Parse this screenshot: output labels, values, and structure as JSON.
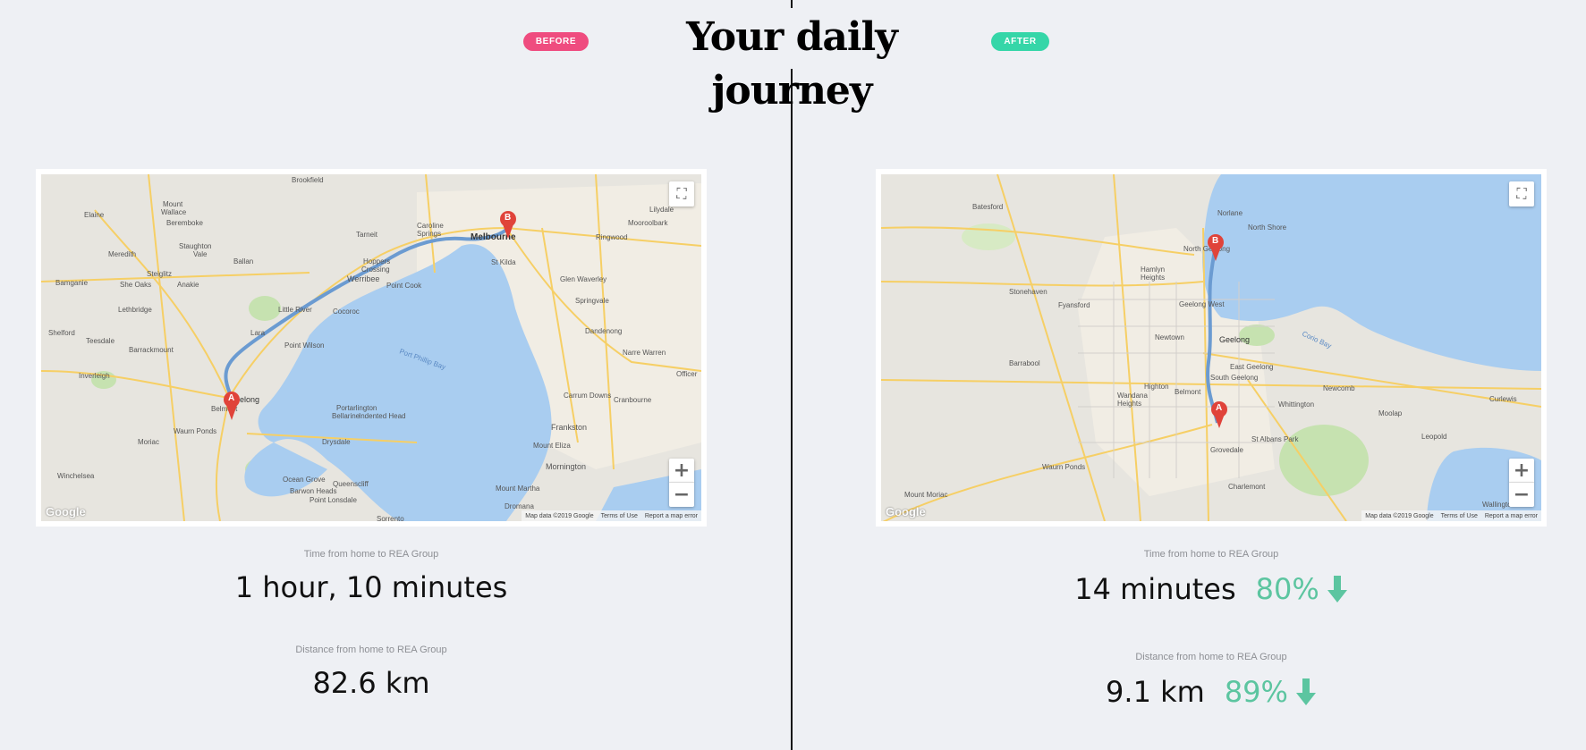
{
  "header": {
    "title": "Your daily journey",
    "before_label": "BEFORE",
    "after_label": "AFTER"
  },
  "before": {
    "map": {
      "place_labels": [
        "Brookfield",
        "Mount Wallace",
        "Elaine",
        "Beremboke",
        "Staughton Vale",
        "Meredith",
        "Ballan",
        "Tarneit",
        "Caroline Springs",
        "Melbourne",
        "St Kilda",
        "Ringwood",
        "Mooroolbark",
        "Lilydale",
        "Werribee",
        "Hoppers Crossing",
        "Point Cook",
        "Little River",
        "Cocoroc",
        "Anakie",
        "She Oaks",
        "Steiglitz",
        "Bamganie",
        "Lethbridge",
        "Shelford",
        "Teesdale",
        "Lara",
        "Point Wilson",
        "Barrackmount",
        "Inverleigh",
        "Geelong",
        "Belmont",
        "Waurn Ponds",
        "Moriac",
        "Winchelsea",
        "Portarlington",
        "Bellarine",
        "Indented Head",
        "Drysdale",
        "Ocean Grove",
        "Barwon Heads",
        "Queenscliff",
        "Point Lonsdale",
        "Port Phillip Bay",
        "Glen Waverley",
        "Springvale",
        "Dandenong",
        "Narre Warren",
        "Officer",
        "Carrum Downs",
        "Cranbourne",
        "Frankston",
        "Mount Eliza",
        "Mornington",
        "Mount Martha",
        "Dromana",
        "Sorrento"
      ],
      "route_color": "#6b9bd1",
      "marker_a": "A",
      "marker_b": "B",
      "google": "Google",
      "map_data": "Map data ©2019 Google",
      "terms": "Terms of Use",
      "report": "Report a map error"
    },
    "time_label": "Time from home to REA Group",
    "time_value": "1 hour, 10 minutes",
    "distance_label": "Distance from home to REA Group",
    "distance_value": "82.6 km"
  },
  "after": {
    "map": {
      "place_labels": [
        "Batesford",
        "Norlane",
        "North Shore",
        "North Geelong",
        "Hamlyn Heights",
        "Stonehaven",
        "Fyansford",
        "Geelong West",
        "Geelong",
        "Newtown",
        "Barrabool",
        "East Geelong",
        "South Geelong",
        "Newcomb",
        "Whittington",
        "Moolap",
        "Curlewis",
        "Highton",
        "Wandana Heights",
        "Belmont",
        "Leopold",
        "St Albans Park",
        "Grovedale",
        "Waurn Ponds",
        "Charlemont",
        "Mount Moriac",
        "Wallington",
        "Corio Bay"
      ],
      "route_color": "#6b9bd1",
      "marker_a": "A",
      "marker_b": "B",
      "google": "Google",
      "map_data": "Map data ©2019 Google",
      "terms": "Terms of Use",
      "report": "Report a map error"
    },
    "time_label": "Time from home to REA Group",
    "time_value": "14 minutes",
    "time_change": "80%",
    "distance_label": "Distance from home to REA Group",
    "distance_value": "9.1 km",
    "distance_change": "89%"
  },
  "colors": {
    "before_pill": "#ef4c7f",
    "after_pill": "#35d6a8",
    "improvement": "#5cc5a0",
    "water": "#a9cdf0",
    "land": "#e7e5df",
    "park": "#b9dca0",
    "road": "#f6cf65"
  },
  "icons": [
    "fullscreen-icon",
    "plus-icon",
    "minus-icon",
    "down-arrow-icon",
    "map-marker-icon"
  ]
}
